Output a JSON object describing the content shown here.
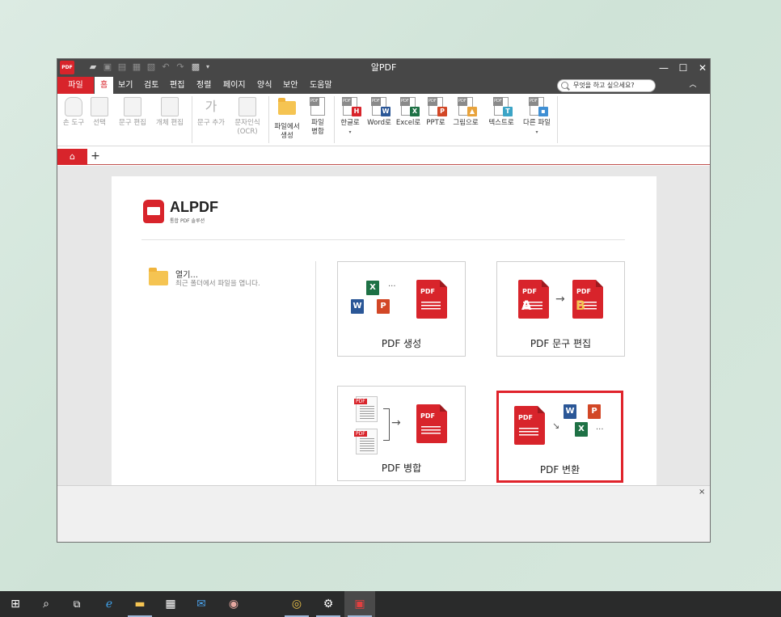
{
  "window": {
    "title": "알PDF",
    "logo_text": "PDF",
    "controls": {
      "minimize": "—",
      "maximize": "☐",
      "close": "✕"
    }
  },
  "quick_access": [
    "open-icon",
    "save-icon",
    "save-as-icon",
    "print-icon",
    "print-preview-icon",
    "undo-icon",
    "redo-icon",
    "settings-icon",
    "customize-icon"
  ],
  "menu": {
    "items": [
      "파일",
      "홈",
      "보기",
      "검토",
      "편집",
      "정렬",
      "페이지",
      "양식",
      "보안",
      "도움말"
    ],
    "active": "홈",
    "search_placeholder": "무엇을 하고 싶으세요?",
    "collapse": "︿"
  },
  "ribbon": {
    "groups": [
      {
        "buttons": [
          {
            "label": "손 도구",
            "icon": "hand-icon",
            "enabled": false
          },
          {
            "label": "선택",
            "icon": "select-text-icon",
            "enabled": false
          },
          {
            "label": "문구 편집",
            "icon": "edit-text-icon",
            "enabled": false
          },
          {
            "label": "개체 편집",
            "icon": "edit-object-icon",
            "enabled": false
          }
        ]
      },
      {
        "buttons": [
          {
            "label": "문구 추가",
            "icon": "add-text-icon",
            "enabled": false
          },
          {
            "label": "문자인식",
            "label2": "(OCR)",
            "icon": "ocr-icon",
            "enabled": false
          }
        ]
      },
      {
        "buttons": [
          {
            "label": "파일에서",
            "label2": "생성",
            "icon": "folder-icon",
            "enabled": true
          },
          {
            "label": "파일",
            "label2": "병합",
            "icon": "merge-icon",
            "enabled": true
          }
        ]
      },
      {
        "buttons": [
          {
            "label": "한글로",
            "icon": "hwp-icon",
            "badge": "H",
            "color": "#d8242b",
            "enabled": true
          },
          {
            "label": "Word로",
            "icon": "word-icon",
            "badge": "W",
            "color": "#2b5797",
            "enabled": true
          },
          {
            "label": "Excel로",
            "icon": "excel-icon",
            "badge": "X",
            "color": "#1e7145",
            "enabled": true
          },
          {
            "label": "PPT로",
            "icon": "ppt-icon",
            "badge": "P",
            "color": "#d24726",
            "enabled": true
          },
          {
            "label": "그림으로",
            "icon": "image-icon",
            "badge": "▲",
            "color": "#e8a33c",
            "enabled": true
          },
          {
            "label": "텍스트로",
            "icon": "text-icon",
            "badge": "T",
            "color": "#3ba4c6",
            "enabled": true
          },
          {
            "label": "다른 파일",
            "icon": "other-file-icon",
            "enabled": true
          }
        ]
      }
    ]
  },
  "tabs": {
    "home": "⌂",
    "add": "+"
  },
  "start_page": {
    "brand": "ALPDF",
    "brand_sub": "통합 PDF 솔루션",
    "open": {
      "title": "열기...",
      "desc": "최근 폴더에서 파일을 엽니다."
    },
    "cards": [
      {
        "label": "PDF 생성",
        "highlight": false
      },
      {
        "label": "PDF 문구 편집",
        "highlight": false
      },
      {
        "label": "PDF 병합",
        "highlight": false
      },
      {
        "label": "PDF 변환",
        "highlight": true
      }
    ],
    "card_glyphs": {
      "arrow": "→",
      "dots": "···",
      "pdf": "PDF",
      "a": "A",
      "b": "B"
    }
  },
  "bottom_pane": {
    "close": "×"
  },
  "taskbar": [
    "windows-start-icon",
    "search-icon",
    "task-view-icon",
    "edge-icon",
    "file-explorer-icon",
    "store-icon",
    "mail-icon",
    "paint-icon",
    "chrome-icon",
    "settings-icon",
    "alpdf-icon"
  ]
}
